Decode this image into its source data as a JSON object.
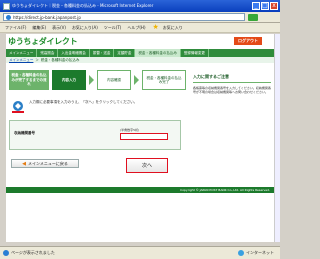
{
  "window": {
    "title": "ゆうちょダイレクト｜税金・各種料金の払込み - Microsoft Internet Explorer",
    "minimize": "_",
    "maximize": "□",
    "close": "x"
  },
  "address": {
    "url": "https://direct.jp-bank.japanpost.jp"
  },
  "menu": {
    "items": [
      "ファイル(F)",
      "編集(E)",
      "表示(V)",
      "お気に入り(A)",
      "ツール(T)",
      "ヘルプ(H)"
    ],
    "favorites_label": "お気に入り"
  },
  "site": {
    "logo": "ゆうちょダイレクト",
    "logout": "ログアウト",
    "nav": [
      "メインメニュー",
      "残高照会",
      "入出金明細照会",
      "振替・送金",
      "定額貯金",
      "税金・各種料金の払込み",
      "登録情報変更"
    ],
    "breadcrumb": {
      "link": "メインメニュー",
      "separator": "＞",
      "current": "税金・各種料金の払込み"
    }
  },
  "steps": {
    "label": "税金・各種料金の払込みが完了するまでの流れ",
    "current": "内容入力",
    "next": "内容確認",
    "done": "税金・各種料金の払込み完了"
  },
  "main": {
    "instruction": "入力欄に必要事項を入力のうえ、「次へ」をクリックしてください。",
    "form_label": "収納機関番号",
    "form_hint": "(半角数字5桁)",
    "form_value": ""
  },
  "side": {
    "title": "入力に関するご注意",
    "text": "各帳票等の収納機関番号を入力してください。収納機関番号が不明の場合は収納機関等へお問い合わせください。"
  },
  "buttons": {
    "back": "メインメニューに戻る",
    "next": "次へ"
  },
  "footer": {
    "copyright": "Copyright © JAPAN POST BANK Co.,Ltd. All Rights Reserved."
  },
  "status": {
    "text": "ページが表示されました",
    "zone": "インターネット"
  }
}
